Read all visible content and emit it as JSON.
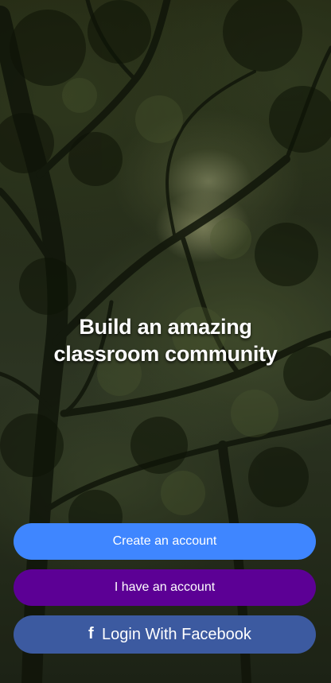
{
  "hero": {
    "line1": "Build an amazing",
    "line2": "classroom community"
  },
  "actions": {
    "create_label": "Create an account",
    "login_label": "I have an account",
    "facebook_label": "Login With Facebook",
    "facebook_icon": "f"
  },
  "colors": {
    "create": "#3f86ff",
    "login": "#5c0095",
    "facebook": "#3c5aa0"
  },
  "icons": {
    "facebook": "facebook-icon"
  }
}
